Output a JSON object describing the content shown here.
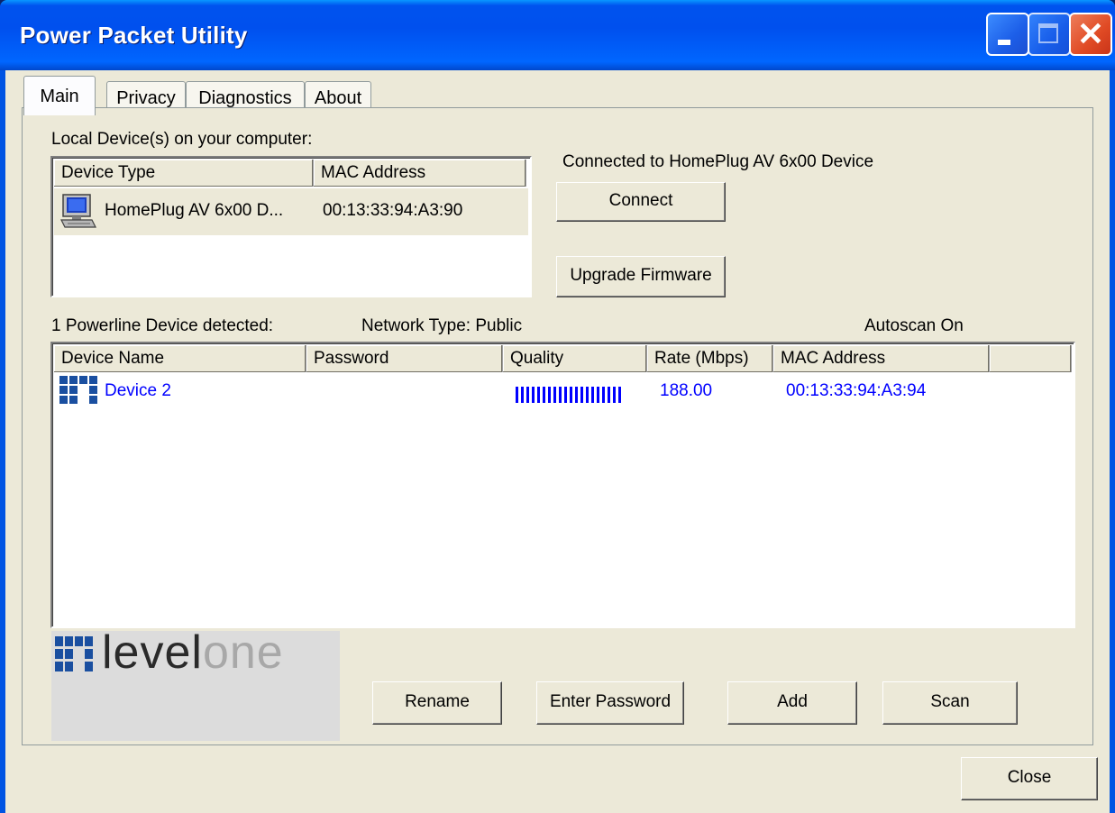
{
  "window": {
    "title": "Power Packet Utility"
  },
  "tabs": [
    {
      "label": "Main"
    },
    {
      "label": "Privacy"
    },
    {
      "label": "Diagnostics"
    },
    {
      "label": "About"
    }
  ],
  "local": {
    "heading": "Local Device(s) on your computer:",
    "columns": [
      "Device Type",
      "MAC Address"
    ],
    "rows": [
      {
        "type": "HomePlug AV 6x00 D...",
        "mac": "00:13:33:94:A3:90"
      }
    ]
  },
  "connection": {
    "status": "Connected to HomePlug AV 6x00 Device",
    "connect_label": "Connect",
    "upgrade_label": "Upgrade Firmware"
  },
  "powerline": {
    "detected": "1 Powerline Device detected:",
    "network_type": "Network Type: Public",
    "autoscan": "Autoscan On",
    "columns": [
      "Device Name",
      "Password",
      "Quality",
      "Rate (Mbps)",
      "MAC Address"
    ],
    "rows": [
      {
        "name": "Device 2",
        "password": "",
        "quality_level": 1.0,
        "rate": "188.00",
        "mac": "00:13:33:94:A3:94"
      }
    ]
  },
  "logo": {
    "text_dark": "level",
    "text_light": "one"
  },
  "actions": {
    "rename": "Rename",
    "enter_password": "Enter Password",
    "add": "Add",
    "scan": "Scan"
  },
  "footer": {
    "close": "Close"
  },
  "colors": {
    "accent": "#0000ff",
    "title_bar": "#0054e3",
    "face": "#ece9d8",
    "logo_blue": "#1a4fa0"
  }
}
